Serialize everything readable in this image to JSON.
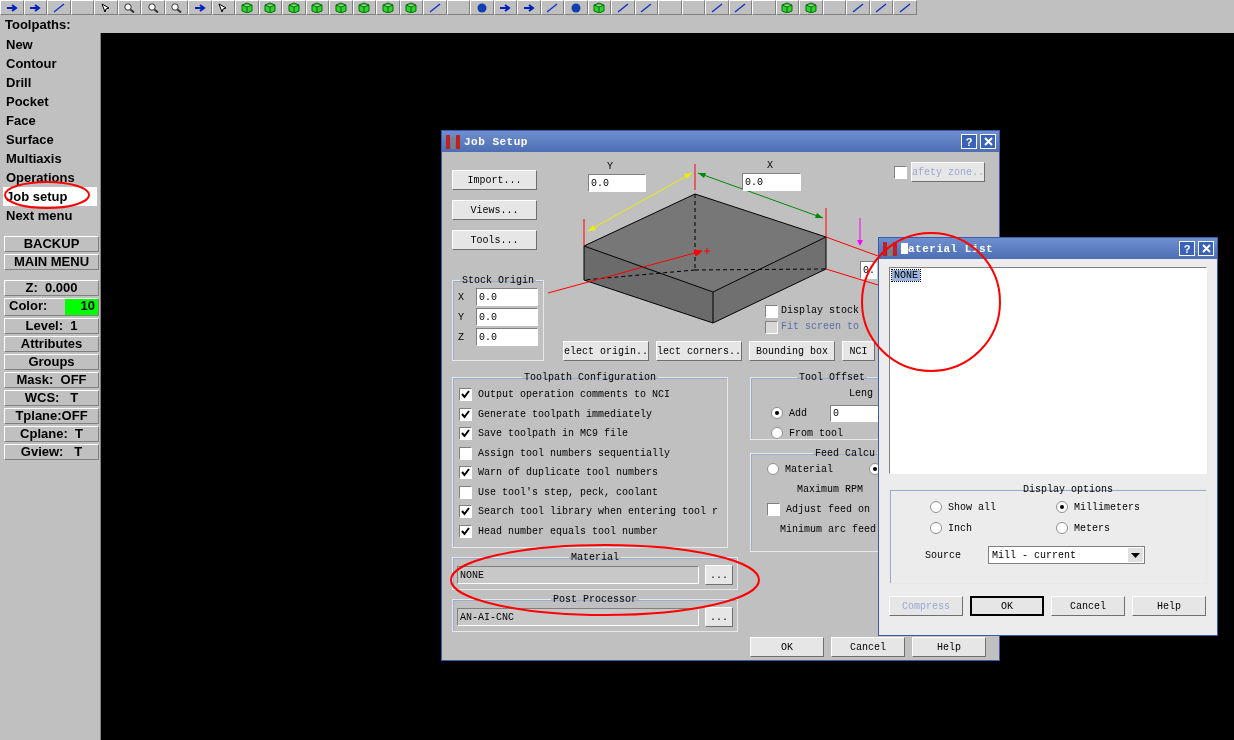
{
  "toolbar": {
    "section_label": "Toolpaths:"
  },
  "menu": {
    "items": [
      {
        "label": "New",
        "selected": false
      },
      {
        "label": "Contour",
        "selected": false
      },
      {
        "label": "Drill",
        "selected": false
      },
      {
        "label": "Pocket",
        "selected": false
      },
      {
        "label": "Face",
        "selected": false
      },
      {
        "label": "Surface",
        "selected": false
      },
      {
        "label": "Multiaxis",
        "selected": false
      },
      {
        "label": "Operations",
        "selected": false
      },
      {
        "label": "Job setup",
        "selected": true
      },
      {
        "label": "Next menu",
        "selected": false
      }
    ],
    "nav_buttons": [
      "BACKUP",
      "MAIN MENU"
    ],
    "status": [
      {
        "kind": "text",
        "label": "Z:  0.000"
      },
      {
        "kind": "color",
        "label": "Color:",
        "value": "10",
        "color": "#00ff00"
      },
      {
        "kind": "text",
        "label": "Level:  1"
      },
      {
        "kind": "text",
        "label": "Attributes"
      },
      {
        "kind": "text",
        "label": "Groups"
      },
      {
        "kind": "text",
        "label": "Mask:  OFF"
      },
      {
        "kind": "text",
        "label": "WCS:   T"
      },
      {
        "kind": "text",
        "label": "Tplane:OFF"
      },
      {
        "kind": "text",
        "label": "Cplane:  T"
      },
      {
        "kind": "text",
        "label": "Gview:   T"
      }
    ]
  },
  "job_setup": {
    "title": "Job Setup",
    "help_button": "?",
    "side_buttons": [
      "Import...",
      "Views...",
      "Tools..."
    ],
    "dimensions": {
      "y_label": "Y",
      "y_value": "0.0",
      "x_label": "X",
      "x_value": "0.0",
      "z_value": "0."
    },
    "safety_zone": {
      "checked": false,
      "label": "afety zone.."
    },
    "display_stock": {
      "label": "Display stock",
      "checked": false
    },
    "fit_screen": {
      "label": "Fit screen to",
      "checked": false,
      "disabled": true
    },
    "stock_origin": {
      "title": "Stock Origin",
      "fields": [
        {
          "label": "X",
          "value": "0.0"
        },
        {
          "label": "Y",
          "value": "0.0"
        },
        {
          "label": "Z",
          "value": "0.0"
        }
      ]
    },
    "origin_buttons": [
      "elect origin..",
      "lect corners..",
      "Bounding box",
      "NCI"
    ],
    "toolpath_config": {
      "title": "Toolpath Configuration",
      "options": [
        {
          "label": "Output operation comments to NCI",
          "checked": true
        },
        {
          "label": "Generate toolpath immediately",
          "checked": true
        },
        {
          "label": "Save toolpath in MC9 file",
          "checked": true
        },
        {
          "label": "Assign tool numbers sequentially",
          "checked": false
        },
        {
          "label": "Warn of duplicate tool numbers",
          "checked": true
        },
        {
          "label": "Use tool's step, peck, coolant",
          "checked": false
        },
        {
          "label": "Search tool library when entering tool r",
          "checked": true
        },
        {
          "label": "Head number equals tool number",
          "checked": true
        }
      ]
    },
    "tool_offset": {
      "title": "Tool Offset",
      "length_label": "Leng",
      "length_value": "0",
      "options": [
        {
          "label": "Add",
          "selected": true
        },
        {
          "label": "From tool",
          "selected": false
        }
      ]
    },
    "feed_calc": {
      "title": "Feed Calcu",
      "options": [
        {
          "label": "Material",
          "selected": false
        },
        {
          "selected": true
        }
      ],
      "max_rpm_label": "Maximum RPM",
      "adjust_feed": {
        "label": "Adjust feed on",
        "checked": false
      },
      "min_arc_label": "Minimum arc feed"
    },
    "material": {
      "title": "Material",
      "value": "NONE",
      "button": "..."
    },
    "post_processor": {
      "title": "Post Processor",
      "value": "AN-AI-CNC",
      "button": "..."
    },
    "buttons": [
      "OK",
      "Cancel",
      "Help"
    ]
  },
  "material_list": {
    "title": "aterial List",
    "help_button": "?",
    "items": [
      {
        "label": "NONE",
        "selected": true
      }
    ],
    "display_options": {
      "title": "Display options",
      "options": [
        {
          "label": "Show all",
          "selected": false
        },
        {
          "label": "Millimeters",
          "selected": true
        },
        {
          "label": "Inch",
          "selected": false
        },
        {
          "label": "Meters",
          "selected": false
        }
      ]
    },
    "source": {
      "label": "Source",
      "value": "Mill - current"
    },
    "buttons": [
      {
        "label": "Compress",
        "disabled": true,
        "default": false
      },
      {
        "label": "OK",
        "disabled": false,
        "default": true
      },
      {
        "label": "Cancel",
        "disabled": false,
        "default": false
      },
      {
        "label": "Help",
        "disabled": false,
        "default": false
      }
    ]
  }
}
